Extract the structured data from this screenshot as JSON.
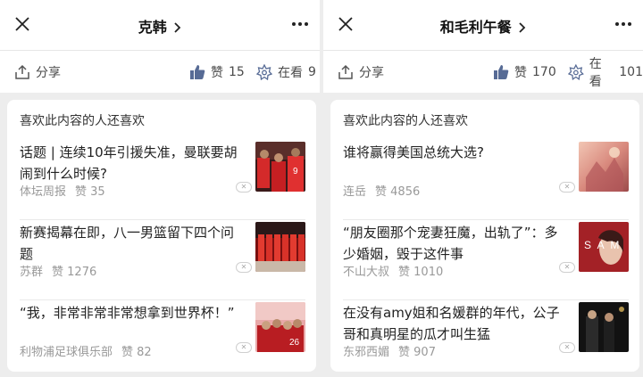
{
  "left": {
    "title": "克韩",
    "share_label": "分享",
    "like_label": "赞",
    "like_count": "15",
    "watching_label": "在看",
    "watching_count": "9",
    "section_title": "喜欢此内容的人还喜欢",
    "items": [
      {
        "text": "话题 | 连续10年引援失准，曼联要胡闹到什么时候?",
        "source": "体坛周报",
        "likes": "赞 35"
      },
      {
        "text": "新赛揭幕在即，八一男篮留下四个问题",
        "source": "苏群",
        "likes": "赞 1276"
      },
      {
        "text": "“我，非常非常非常想拿到世界杯！”",
        "source": "利物浦足球俱乐部",
        "likes": "赞 82"
      }
    ]
  },
  "right": {
    "title": "和毛利午餐",
    "share_label": "分享",
    "like_label": "赞",
    "like_count": "170",
    "watching_label": "在看",
    "watching_count": "101",
    "section_title": "喜欢此内容的人还喜欢",
    "items": [
      {
        "text": "谁将赢得美国总统大选?",
        "source": "连岳",
        "likes": "赞 4856"
      },
      {
        "text": "“朋友圈那个宠妻狂魔，出轨了”：多少婚姻，毁于这件事",
        "source": "不山大叔",
        "likes": "赞 1010"
      },
      {
        "text": "在没有amy姐和名媛群的年代，公子哥和真明星的瓜才叫生猛",
        "source": "东邪西媚",
        "likes": "赞 907"
      }
    ]
  },
  "icons": {
    "close": "close-icon",
    "more": "more-dots-icon",
    "share": "share-icon",
    "like": "thumbs-up-icon",
    "watching": "watching-icon",
    "chevron": "chevron-right-icon",
    "dismiss": "dismiss-x-icon"
  },
  "colors": {
    "background": "#ededed",
    "card": "#ffffff",
    "like_blue": "#576b95",
    "meta_gray": "#999999"
  }
}
